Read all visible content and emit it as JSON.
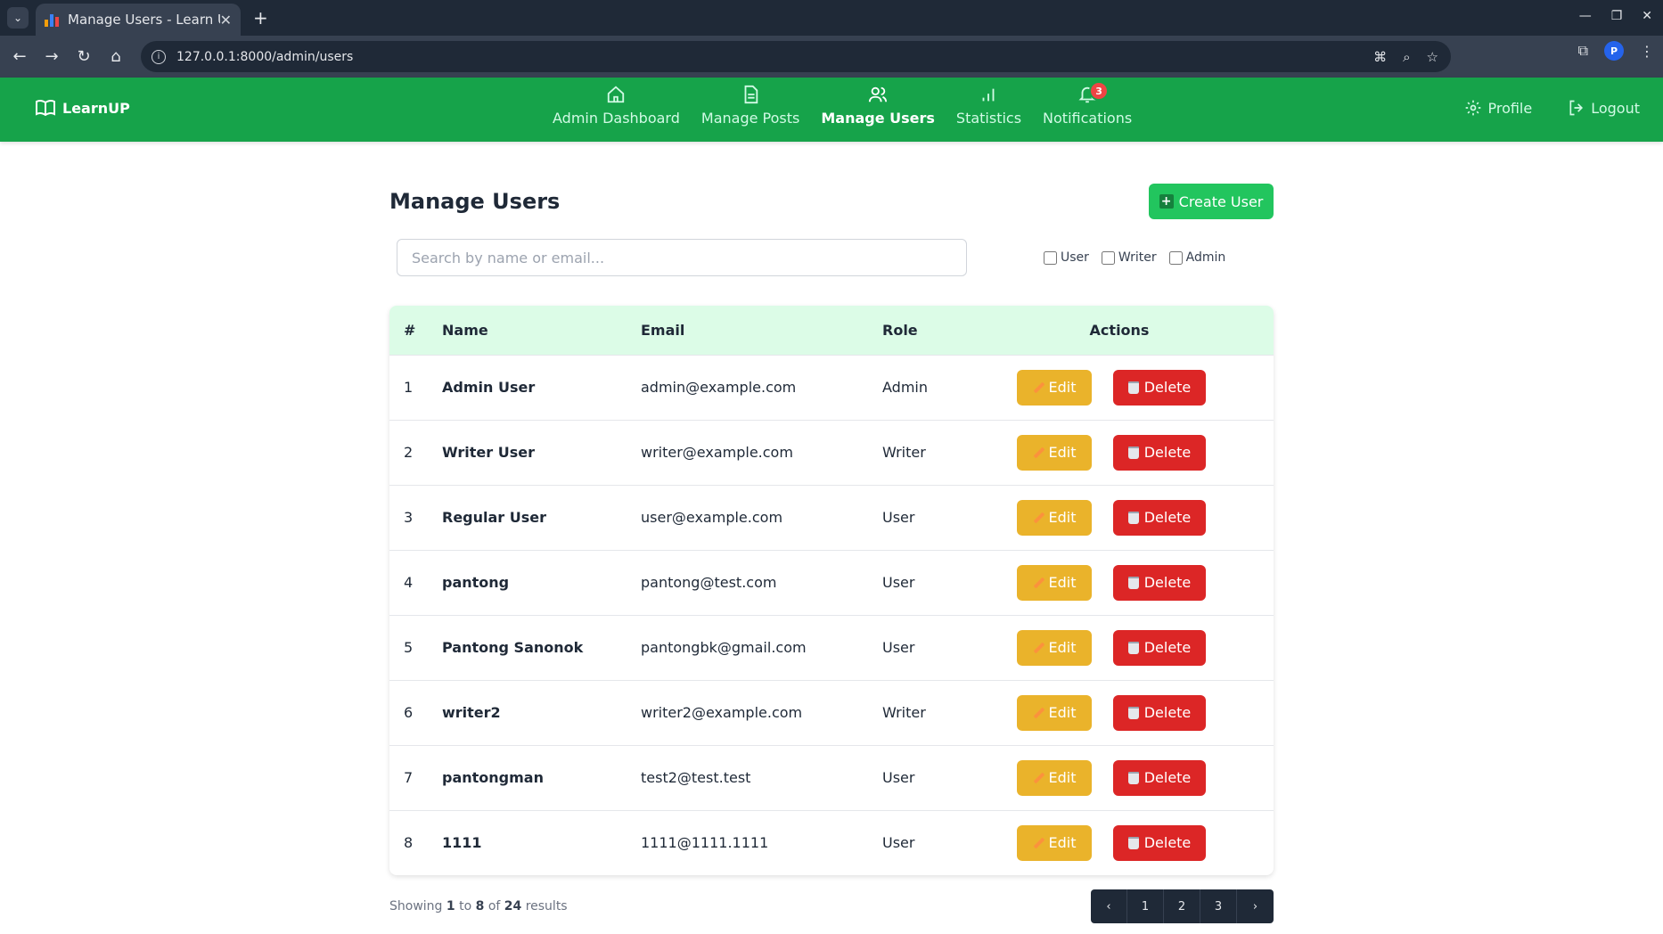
{
  "browser": {
    "tab_title": "Manage Users - Learn Up",
    "tab_close": "✕",
    "new_tab": "+",
    "url": "127.0.0.1:8000/admin/users",
    "profile_initial": "P"
  },
  "nav": {
    "brand": "LearnUP",
    "links": [
      {
        "label": "Admin Dashboard",
        "icon": "home-icon"
      },
      {
        "label": "Manage Posts",
        "icon": "document-icon"
      },
      {
        "label": "Manage Users",
        "icon": "users-icon",
        "active": true
      },
      {
        "label": "Statistics",
        "icon": "chart-icon"
      },
      {
        "label": "Notifications",
        "icon": "bell-icon",
        "badge": "3"
      }
    ],
    "profile": "Profile",
    "logout": "Logout"
  },
  "page": {
    "title": "Manage Users",
    "create_button": "Create User",
    "search_placeholder": "Search by name or email...",
    "role_filters": [
      {
        "label": "User",
        "checked": false
      },
      {
        "label": "Writer",
        "checked": false
      },
      {
        "label": "Admin",
        "checked": false
      }
    ]
  },
  "table": {
    "columns": [
      "#",
      "Name",
      "Email",
      "Role",
      "Actions"
    ],
    "edit_label": "Edit",
    "delete_label": "Delete",
    "rows": [
      {
        "num": "1",
        "name": "Admin User",
        "email": "admin@example.com",
        "role": "Admin"
      },
      {
        "num": "2",
        "name": "Writer User",
        "email": "writer@example.com",
        "role": "Writer"
      },
      {
        "num": "3",
        "name": "Regular User",
        "email": "user@example.com",
        "role": "User"
      },
      {
        "num": "4",
        "name": "pantong",
        "email": "pantong@test.com",
        "role": "User"
      },
      {
        "num": "5",
        "name": "Pantong Sanonok",
        "email": "pantongbk@gmail.com",
        "role": "User"
      },
      {
        "num": "6",
        "name": "writer2",
        "email": "writer2@example.com",
        "role": "Writer"
      },
      {
        "num": "7",
        "name": "pantongman",
        "email": "test2@test.test",
        "role": "User"
      },
      {
        "num": "8",
        "name": "1111",
        "email": "1111@1111.1111",
        "role": "User"
      }
    ]
  },
  "pagination": {
    "showing_prefix": "Showing",
    "from": "1",
    "to_word": "to",
    "to": "8",
    "of_word": "of",
    "total": "24",
    "results_word": "results",
    "pages": [
      "1",
      "2",
      "3"
    ],
    "prev": "‹",
    "next": "›"
  },
  "colors": {
    "nav_bg": "#16a34a",
    "create_button": "#22c55e",
    "edit_button": "#eab32b",
    "delete_button": "#dc2626",
    "header_row": "#dcfce7",
    "badge": "#ef4444"
  }
}
